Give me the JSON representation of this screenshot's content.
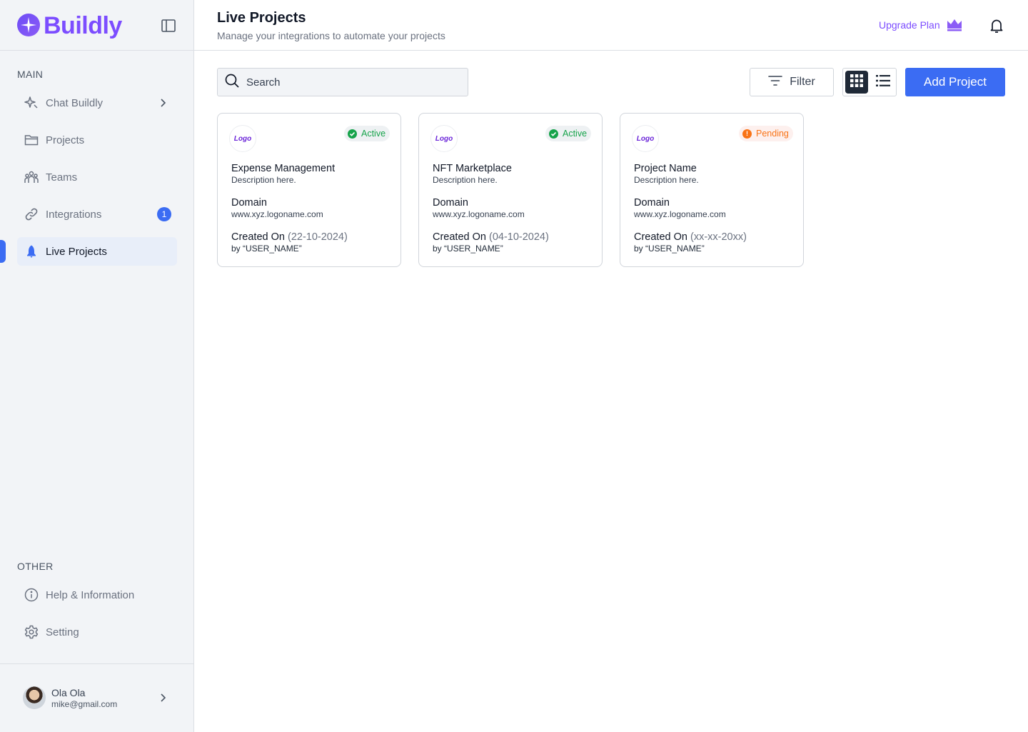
{
  "brand": {
    "name": "Buildly"
  },
  "sidebar": {
    "main_label": "MAIN",
    "other_label": "OTHER",
    "items": [
      {
        "label": "Chat Buildly",
        "icon": "sparkle-icon"
      },
      {
        "label": "Projects",
        "icon": "folder-icon"
      },
      {
        "label": "Teams",
        "icon": "users-icon"
      },
      {
        "label": "Integrations",
        "icon": "link-icon",
        "badge": "1"
      },
      {
        "label": "Live Projects",
        "icon": "rocket-icon",
        "active": true
      }
    ],
    "other_items": [
      {
        "label": "Help & Information",
        "icon": "info-icon"
      },
      {
        "label": "Setting",
        "icon": "gear-icon"
      }
    ],
    "user": {
      "name": "Ola Ola",
      "email": "mike@gmail.com"
    }
  },
  "header": {
    "title": "Live Projects",
    "subtitle": "Manage your integrations to automate your projects",
    "upgrade_label": "Upgrade Plan"
  },
  "toolbar": {
    "search_placeholder": "Search",
    "filter_label": "Filter",
    "add_label": "Add Project"
  },
  "projects": [
    {
      "logo": "Logo",
      "status": "Active",
      "title": "Expense Management",
      "description": "Description here.",
      "domain_label": "Domain",
      "domain": "www.xyz.logoname.com",
      "created_label": "Created On",
      "created_date": "(22-10-2024)",
      "by": "by “USER_NAME”"
    },
    {
      "logo": "Logo",
      "status": "Active",
      "title": "NFT Marketplace",
      "description": "Description here.",
      "domain_label": "Domain",
      "domain": "www.xyz.logoname.com",
      "created_label": "Created On",
      "created_date": "(04-10-2024)",
      "by": "by “USER_NAME”"
    },
    {
      "logo": "Logo",
      "status": "Pending",
      "title": "Project Name",
      "description": "Description here.",
      "domain_label": "Domain",
      "domain": "www.xyz.logoname.com",
      "created_label": "Created On",
      "created_date": "(xx-xx-20xx)",
      "by": "by “USER_NAME”"
    }
  ],
  "colors": {
    "accent": "#3b6cf3",
    "brand": "#7c4dff",
    "active": "#16a34a",
    "pending": "#f97316"
  }
}
